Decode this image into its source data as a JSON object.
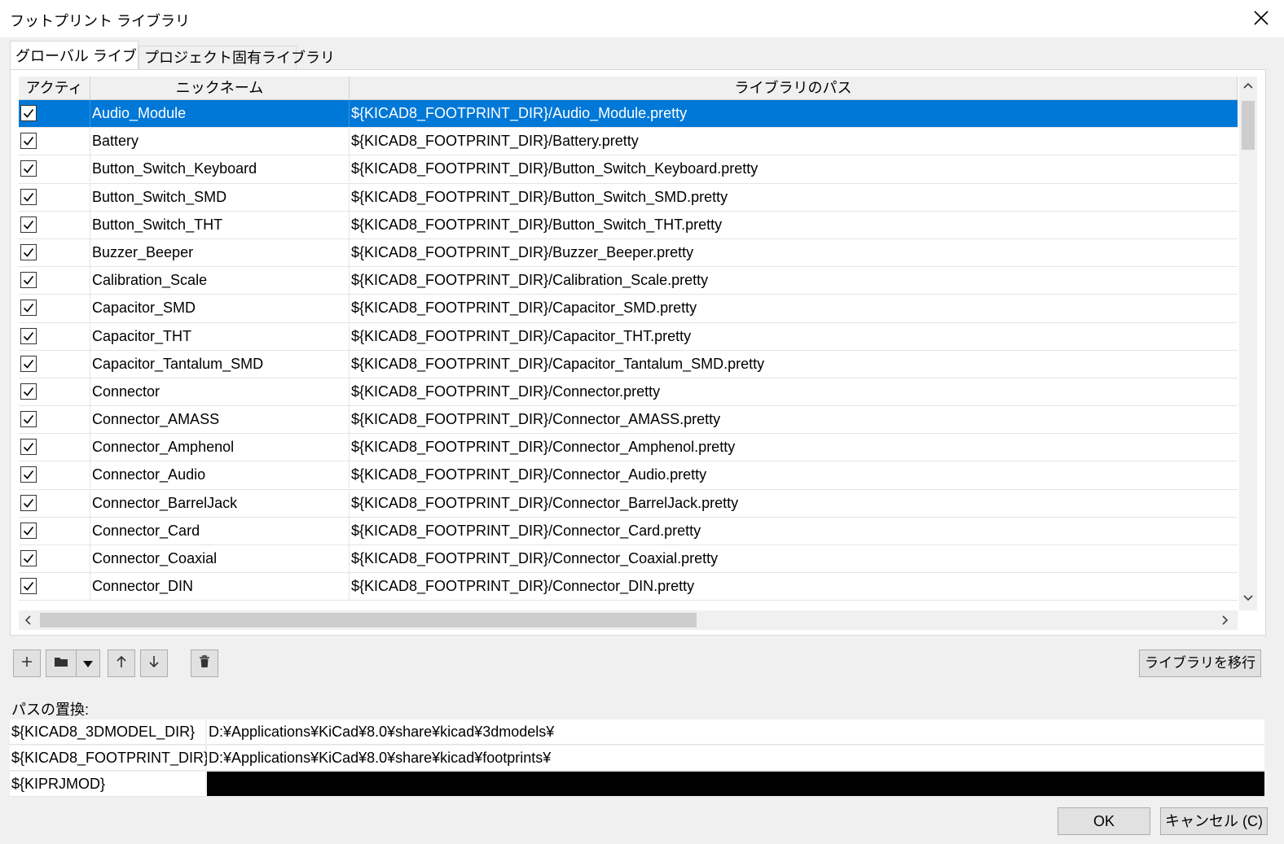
{
  "window": {
    "title": "フットプリント ライブラリ"
  },
  "tabs": [
    {
      "label": "グローバル ライブラリ",
      "active": true
    },
    {
      "label": "プロジェクト固有ライブラリ",
      "active": false
    }
  ],
  "table": {
    "headers": [
      "アクティブ",
      "ニックネーム",
      "ライブラリのパス"
    ],
    "rows": [
      {
        "active": true,
        "nickname": "Audio_Module",
        "path": "${KICAD8_FOOTPRINT_DIR}/Audio_Module.pretty",
        "selected": true
      },
      {
        "active": true,
        "nickname": "Battery",
        "path": "${KICAD8_FOOTPRINT_DIR}/Battery.pretty"
      },
      {
        "active": true,
        "nickname": "Button_Switch_Keyboard",
        "path": "${KICAD8_FOOTPRINT_DIR}/Button_Switch_Keyboard.pretty"
      },
      {
        "active": true,
        "nickname": "Button_Switch_SMD",
        "path": "${KICAD8_FOOTPRINT_DIR}/Button_Switch_SMD.pretty"
      },
      {
        "active": true,
        "nickname": "Button_Switch_THT",
        "path": "${KICAD8_FOOTPRINT_DIR}/Button_Switch_THT.pretty"
      },
      {
        "active": true,
        "nickname": "Buzzer_Beeper",
        "path": "${KICAD8_FOOTPRINT_DIR}/Buzzer_Beeper.pretty"
      },
      {
        "active": true,
        "nickname": "Calibration_Scale",
        "path": "${KICAD8_FOOTPRINT_DIR}/Calibration_Scale.pretty"
      },
      {
        "active": true,
        "nickname": "Capacitor_SMD",
        "path": "${KICAD8_FOOTPRINT_DIR}/Capacitor_SMD.pretty"
      },
      {
        "active": true,
        "nickname": "Capacitor_THT",
        "path": "${KICAD8_FOOTPRINT_DIR}/Capacitor_THT.pretty"
      },
      {
        "active": true,
        "nickname": "Capacitor_Tantalum_SMD",
        "path": "${KICAD8_FOOTPRINT_DIR}/Capacitor_Tantalum_SMD.pretty"
      },
      {
        "active": true,
        "nickname": "Connector",
        "path": "${KICAD8_FOOTPRINT_DIR}/Connector.pretty"
      },
      {
        "active": true,
        "nickname": "Connector_AMASS",
        "path": "${KICAD8_FOOTPRINT_DIR}/Connector_AMASS.pretty"
      },
      {
        "active": true,
        "nickname": "Connector_Amphenol",
        "path": "${KICAD8_FOOTPRINT_DIR}/Connector_Amphenol.pretty"
      },
      {
        "active": true,
        "nickname": "Connector_Audio",
        "path": "${KICAD8_FOOTPRINT_DIR}/Connector_Audio.pretty"
      },
      {
        "active": true,
        "nickname": "Connector_BarrelJack",
        "path": "${KICAD8_FOOTPRINT_DIR}/Connector_BarrelJack.pretty"
      },
      {
        "active": true,
        "nickname": "Connector_Card",
        "path": "${KICAD8_FOOTPRINT_DIR}/Connector_Card.pretty"
      },
      {
        "active": true,
        "nickname": "Connector_Coaxial",
        "path": "${KICAD8_FOOTPRINT_DIR}/Connector_Coaxial.pretty"
      },
      {
        "active": true,
        "nickname": "Connector_DIN",
        "path": "${KICAD8_FOOTPRINT_DIR}/Connector_DIN.pretty"
      }
    ]
  },
  "toolbar": {
    "add_icon": "plus-icon",
    "folder_icon": "folder-icon",
    "dropdown_icon": "triangle-down-icon",
    "up_icon": "arrow-up-icon",
    "down_icon": "arrow-down-icon",
    "delete_icon": "trash-icon",
    "migrate_label": "ライブラリを移行"
  },
  "substitutions": {
    "label": "パスの置換:",
    "rows": [
      {
        "name": "${KICAD8_3DMODEL_DIR}",
        "value": "D:¥Applications¥KiCad¥8.0¥share¥kicad¥3dmodels¥"
      },
      {
        "name": "${KICAD8_FOOTPRINT_DIR}",
        "value": "D:¥Applications¥KiCad¥8.0¥share¥kicad¥footprints¥"
      },
      {
        "name": "${KIPRJMOD}",
        "value": "",
        "redacted": true
      }
    ]
  },
  "buttons": {
    "ok": "OK",
    "cancel": "キャンセル (C)"
  },
  "colors": {
    "selection": "#0078d7",
    "dialog_bg": "#f0f0f0"
  }
}
